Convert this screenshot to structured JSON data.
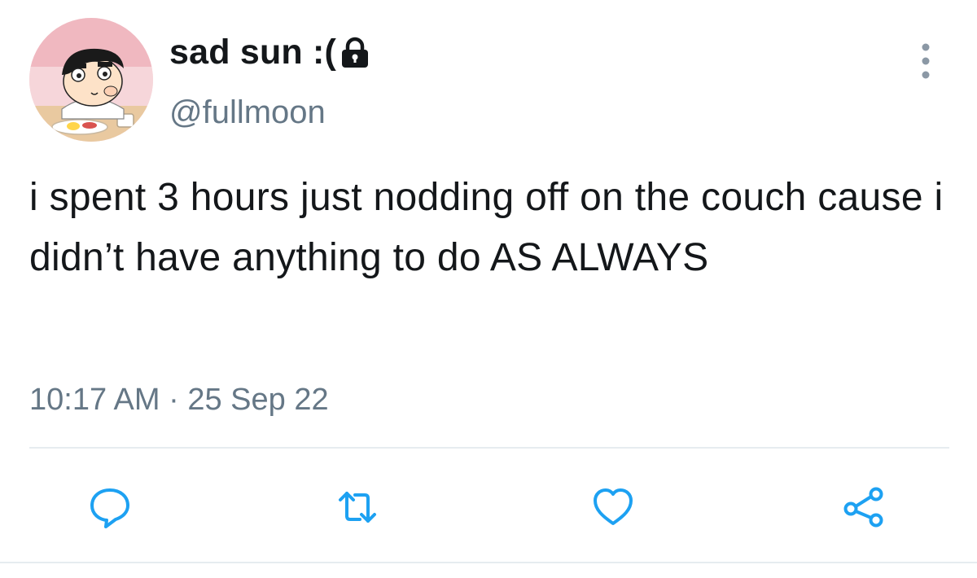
{
  "tweet": {
    "display_name": "sad sun :(",
    "handle": "@fullmoon",
    "text": "i spent 3 hours just nodding off on the couch cause i didn’t have anything to do AS ALWAYS",
    "timestamp": "10:17 AM · 25 Sep 22",
    "protected_account": true
  },
  "icons": {
    "lock": "lock-icon",
    "more": "more-vertical-icon",
    "reply": "reply-icon",
    "retweet": "retweet-icon",
    "like": "heart-icon",
    "share": "share-icon"
  },
  "colors": {
    "text_primary": "#14171a",
    "text_secondary": "#657786",
    "icon": "#1da1f2",
    "divider": "#e6ecf0"
  }
}
